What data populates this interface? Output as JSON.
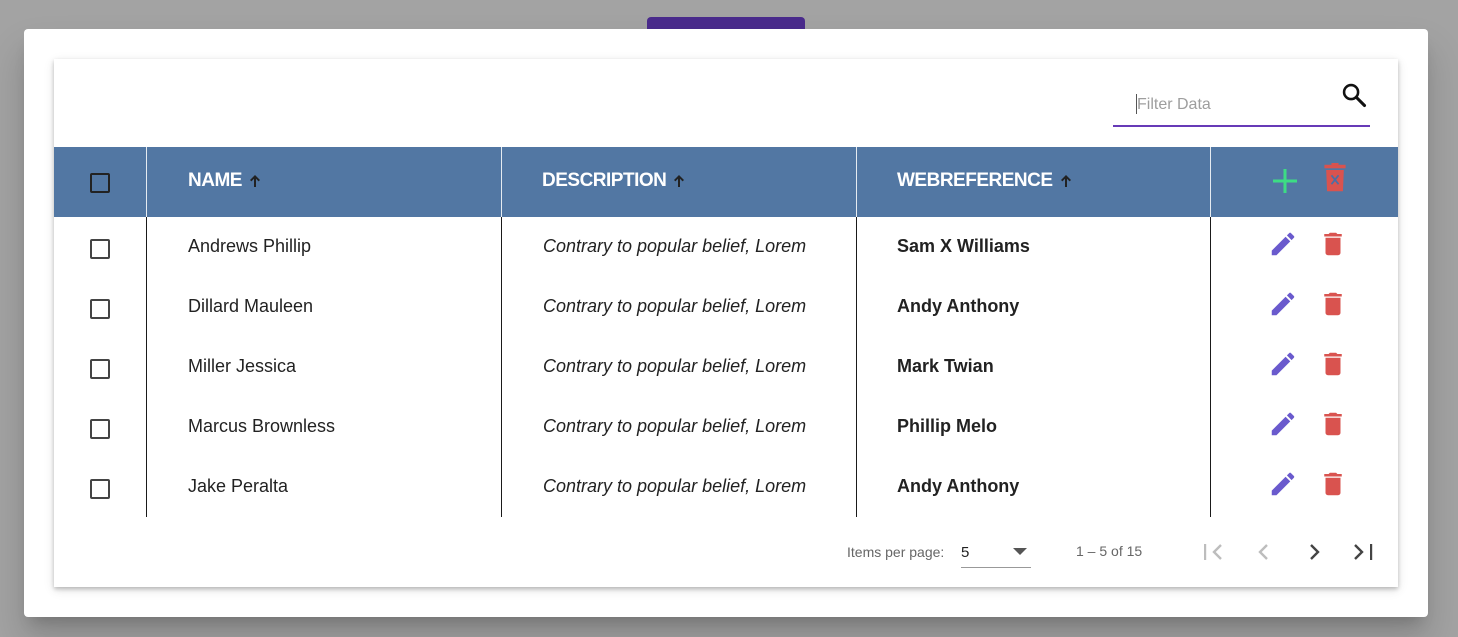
{
  "filter": {
    "placeholder": "Filter Data"
  },
  "columns": [
    {
      "label": "NAME"
    },
    {
      "label": "DESCRIPTION"
    },
    {
      "label": "WEBREFERENCE"
    }
  ],
  "rows": [
    {
      "name": "Andrews Phillip",
      "description": "Contrary to popular belief, Lorem",
      "webreference": "Sam X Williams"
    },
    {
      "name": "Dillard Mauleen",
      "description": "Contrary to popular belief, Lorem",
      "webreference": "Andy Anthony"
    },
    {
      "name": "Miller Jessica",
      "description": "Contrary to popular belief, Lorem",
      "webreference": "Mark Twian"
    },
    {
      "name": "Marcus Brownless",
      "description": "Contrary to popular belief, Lorem",
      "webreference": "Phillip Melo"
    },
    {
      "name": "Jake Peralta",
      "description": "Contrary to popular belief, Lorem",
      "webreference": "Andy Anthony"
    }
  ],
  "paginator": {
    "items_per_page_label": "Items per page:",
    "page_size": "5",
    "range_label": "1 – 5 of 15"
  },
  "colors": {
    "accent": "#673ab7",
    "header_bg": "#5277a3",
    "add": "#3ddc84",
    "delete": "#d9534f",
    "edit": "#6a5acd"
  },
  "icons": [
    "search-icon",
    "sort-arrow-up-icon",
    "add-icon",
    "delete-icon",
    "edit-icon",
    "first-page-icon",
    "prev-page-icon",
    "next-page-icon",
    "last-page-icon",
    "dropdown-arrow-icon"
  ]
}
